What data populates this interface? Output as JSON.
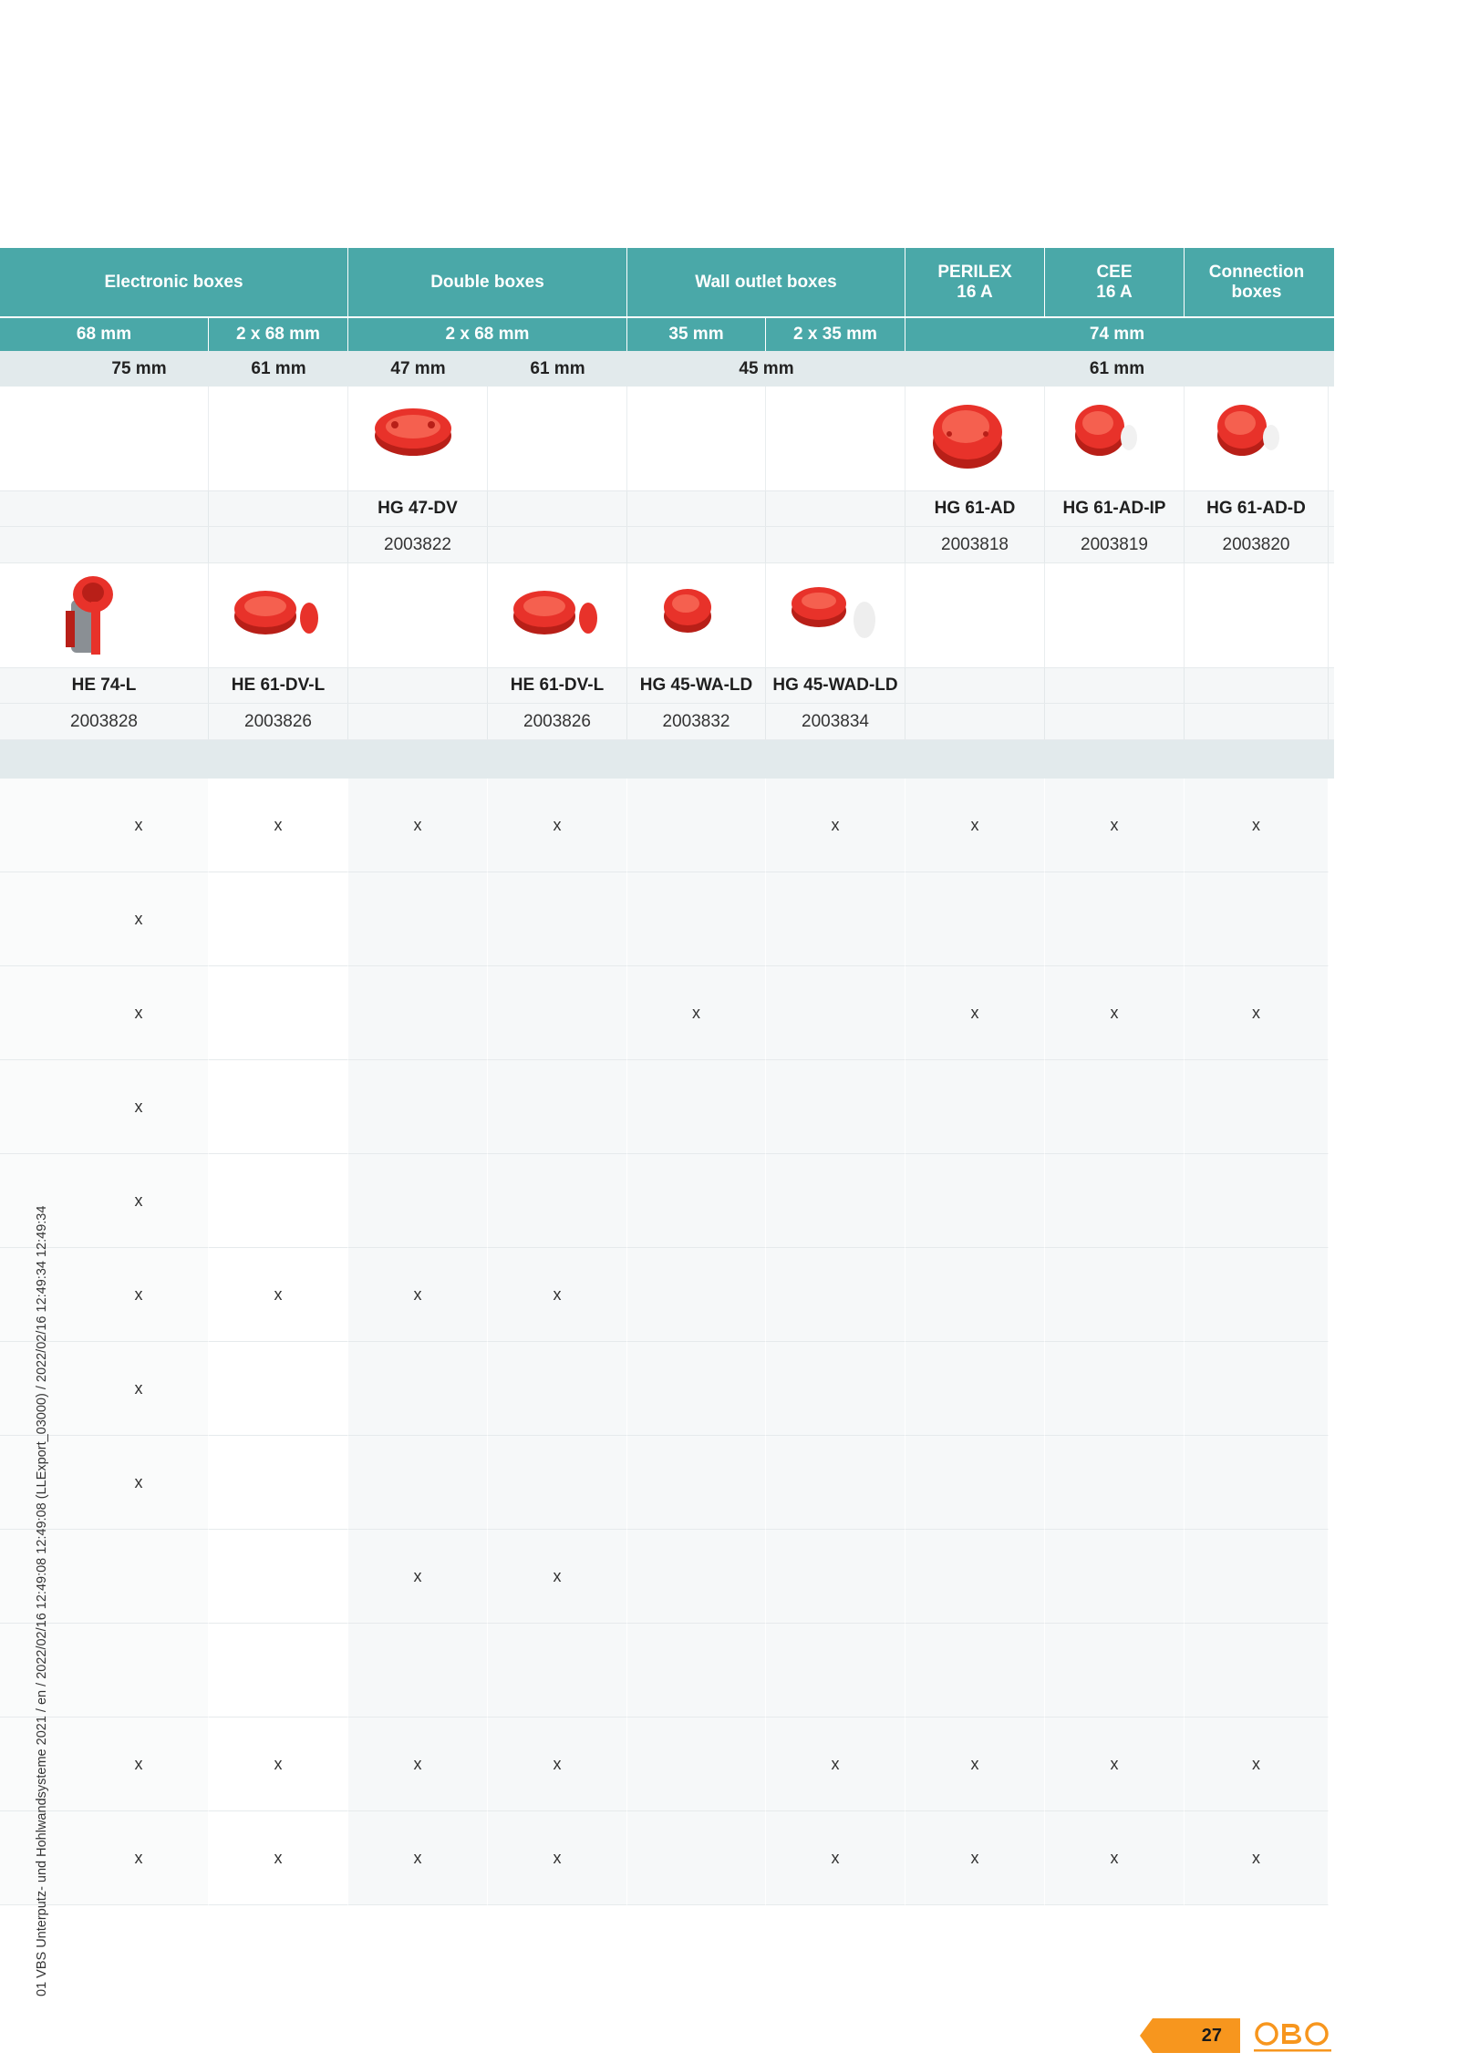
{
  "table": {
    "categories": [
      {
        "label": "Electronic boxes",
        "span": 2
      },
      {
        "label": "Double boxes",
        "span": 2
      },
      {
        "label": "Wall outlet boxes",
        "span": 2
      },
      {
        "label": "PERILEX\n16 A",
        "span": 1
      },
      {
        "label": "CEE\n16 A",
        "span": 1
      },
      {
        "label": "Connection\nboxes",
        "span": 1
      }
    ],
    "diameters": [
      {
        "label": "68 mm",
        "span": 1
      },
      {
        "label": "2 x 68 mm",
        "span": 1
      },
      {
        "label": "2 x 68 mm",
        "span": 2
      },
      {
        "label": "35 mm",
        "span": 1
      },
      {
        "label": "2 x 35 mm",
        "span": 1
      },
      {
        "label": "74 mm",
        "span": 3
      }
    ],
    "depths": [
      {
        "label": "75 mm",
        "span": 1
      },
      {
        "label": "61 mm",
        "span": 1
      },
      {
        "label": "47 mm",
        "span": 1
      },
      {
        "label": "61 mm",
        "span": 1
      },
      {
        "label": "45 mm",
        "span": 2
      },
      {
        "label": "61 mm",
        "span": 3
      }
    ],
    "products_hg": [
      {
        "image": "",
        "name": "",
        "number": ""
      },
      {
        "image": "",
        "name": "",
        "number": ""
      },
      {
        "image": "double-box-red",
        "name": "HG 47-DV",
        "number": "2003822"
      },
      {
        "image": "",
        "name": "",
        "number": ""
      },
      {
        "image": "",
        "name": "",
        "number": ""
      },
      {
        "image": "",
        "name": "",
        "number": ""
      },
      {
        "image": "large-round-box-red",
        "name": "HG 61-AD",
        "number": "2003818"
      },
      {
        "image": "round-box-red",
        "name": "HG 61-AD-IP",
        "number": "2003819"
      },
      {
        "image": "round-box-red",
        "name": "HG 61-AD-D",
        "number": "2003820"
      }
    ],
    "products_he": [
      {
        "image": "electronic-box-red-grey",
        "name": "HE 74-L",
        "number": "2003828"
      },
      {
        "image": "double-box-with-lid-red",
        "name": "HE 61-DV-L",
        "number": "2003826"
      },
      {
        "image": "",
        "name": "",
        "number": ""
      },
      {
        "image": "double-box-with-lid-red",
        "name": "HE 61-DV-L",
        "number": "2003826"
      },
      {
        "image": "wall-outlet-box-red",
        "name": "HG 45-WA-LD",
        "number": "2003832"
      },
      {
        "image": "double-wall-outlet-box-red",
        "name": "HG 45-WAD-LD",
        "number": "2003834"
      },
      {
        "image": "",
        "name": "",
        "number": ""
      },
      {
        "image": "",
        "name": "",
        "number": ""
      },
      {
        "image": "",
        "name": "",
        "number": ""
      }
    ],
    "rows": [
      [
        "x",
        "x",
        "x",
        "x",
        "",
        "x",
        "x",
        "x",
        "x"
      ],
      [
        "x",
        "",
        "",
        "",
        "",
        "",
        "",
        "",
        ""
      ],
      [
        "x",
        "",
        "",
        "",
        "x",
        "",
        "x",
        "x",
        "x"
      ],
      [
        "x",
        "",
        "",
        "",
        "",
        "",
        "",
        "",
        ""
      ],
      [
        "x",
        "",
        "",
        "",
        "",
        "",
        "",
        "",
        ""
      ],
      [
        "x",
        "x",
        "x",
        "x",
        "",
        "",
        "",
        "",
        ""
      ],
      [
        "x",
        "",
        "",
        "",
        "",
        "",
        "",
        "",
        ""
      ],
      [
        "x",
        "",
        "",
        "",
        "",
        "",
        "",
        "",
        ""
      ],
      [
        "",
        "",
        "x",
        "x",
        "",
        "",
        "",
        "",
        ""
      ],
      [
        "",
        "",
        "",
        "",
        "",
        "",
        "",
        "",
        ""
      ],
      [
        "x",
        "x",
        "x",
        "x",
        "",
        "x",
        "x",
        "x",
        "x"
      ],
      [
        "x",
        "x",
        "x",
        "x",
        "",
        "x",
        "x",
        "x",
        "x"
      ]
    ]
  },
  "footer": {
    "side_text": "01 VBS Unterputz- und Hohlwandsysteme 2021 / en / 2022/02/16 12:49:08 12:49:08 (LLExport_03000) / 2022/02/16 12:49:34 12:49:34",
    "page_number": "27",
    "logo": "OBO"
  },
  "colors": {
    "header_teal": "#4aa8a8",
    "depth_grey": "#e2eaec",
    "product_red": "#e8322a",
    "page_tab_orange": "#f7961e",
    "logo_orange": "#f7961e"
  }
}
